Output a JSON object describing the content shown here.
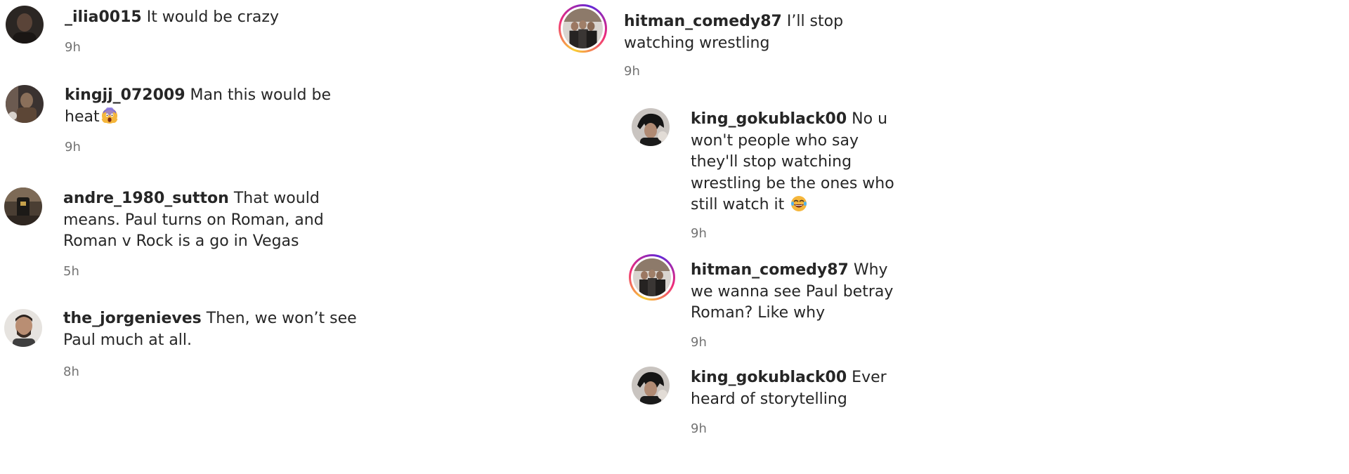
{
  "comments": [
    {
      "username": "_ilia0015",
      "text": "It would be crazy",
      "time": "9h",
      "avatar": "profile-photo"
    },
    {
      "username": "kingjj_072009",
      "text": "Man this would be heat",
      "emoji": "screaming-face-emoji",
      "time": "9h",
      "avatar": "profile-photo"
    },
    {
      "username": "andre_1980_sutton",
      "text": "That would means. Paul turns on Roman, and Roman v Rock is a go in Vegas",
      "time": "5h",
      "avatar": "profile-photo"
    },
    {
      "username": "the_jorgenieves",
      "text": "Then, we won’t see Paul much at all.",
      "time": "8h",
      "avatar": "profile-photo"
    },
    {
      "username": "hitman_comedy87",
      "text": "I’ll stop watching wrestling",
      "time": "9h",
      "avatar": "profile-photo-story-ring"
    },
    {
      "username": "king_gokublack00",
      "text": "No u won't people who say they'll stop watching wrestling be the ones who still watch it",
      "emoji": "laughing-tears-emoji",
      "time": "9h",
      "avatar": "profile-photo"
    },
    {
      "username": "hitman_comedy87",
      "text": "Why we wanna see Paul betray Roman? Like why",
      "time": "9h",
      "avatar": "profile-photo-story-ring"
    },
    {
      "username": "king_gokublack00",
      "text": "Ever heard of storytelling",
      "time": "9h",
      "avatar": "profile-photo"
    }
  ],
  "colors": {
    "username": "#262626",
    "text": "#262626",
    "timestamp": "#737373",
    "story_ring": [
      "#f9ce34",
      "#ee2a7b",
      "#6228d7"
    ]
  }
}
